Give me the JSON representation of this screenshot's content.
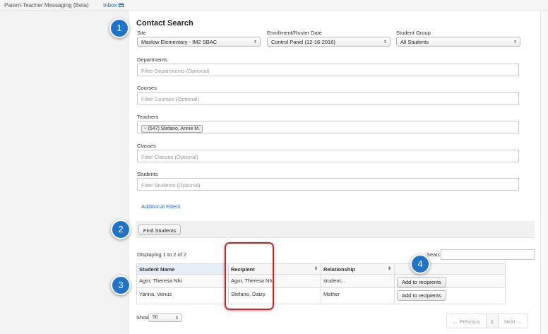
{
  "topbar": {
    "brand": "Parent-Teacher Messaging (Beta)",
    "inbox": "Inbox"
  },
  "title": "Contact Search",
  "site": {
    "label": "Site",
    "value": "Maslow Elementary - IM2 SBAC"
  },
  "enrollment": {
    "label": "Enrollment/Roster Date",
    "value": "Control Panel (12-16-2016)"
  },
  "student_group": {
    "label": "Student Group",
    "value": "All Students"
  },
  "departments": {
    "label": "Departments",
    "placeholder": "Filter Departments (Optional)"
  },
  "courses": {
    "label": "Courses",
    "placeholder": "Filter Courses (Optional)"
  },
  "teachers": {
    "label": "Teachers",
    "tag": "(547) Stefano, Annie M.",
    "tag_remove": "×"
  },
  "classes": {
    "label": "Classes",
    "placeholder": "Filter Classes (Optional)"
  },
  "students": {
    "label": "Students",
    "placeholder": "Filter Students (Optional)"
  },
  "additional_filters": "Additional Filters",
  "find_button": "Find Students",
  "displaying": "Displaying 1 to 2 of 2",
  "search_label": "Search",
  "table": {
    "headers": [
      "Student Name",
      "Recipient",
      "Relationship"
    ],
    "rows": [
      {
        "student": "Agor, Theresa Nhi",
        "recipient": "Agor, Theresa Nhi",
        "relationship": "student...",
        "action": "Add to recipients"
      },
      {
        "student": "Yarina, Venus",
        "recipient": "Stefano, Daizy",
        "relationship": "Mother",
        "action": "Add to recipients"
      }
    ]
  },
  "show": {
    "label": "Show",
    "value": "50"
  },
  "pager": {
    "prev": "← Previous",
    "page": "1",
    "next": "Next →"
  },
  "badges": [
    "1",
    "2",
    "3",
    "4"
  ],
  "colors": {
    "badge": "#1f73c9",
    "highlight": "#c8252b",
    "link": "#1a6fbf"
  },
  "icons": {
    "select_caret": "⇕",
    "sort": "⇕"
  }
}
